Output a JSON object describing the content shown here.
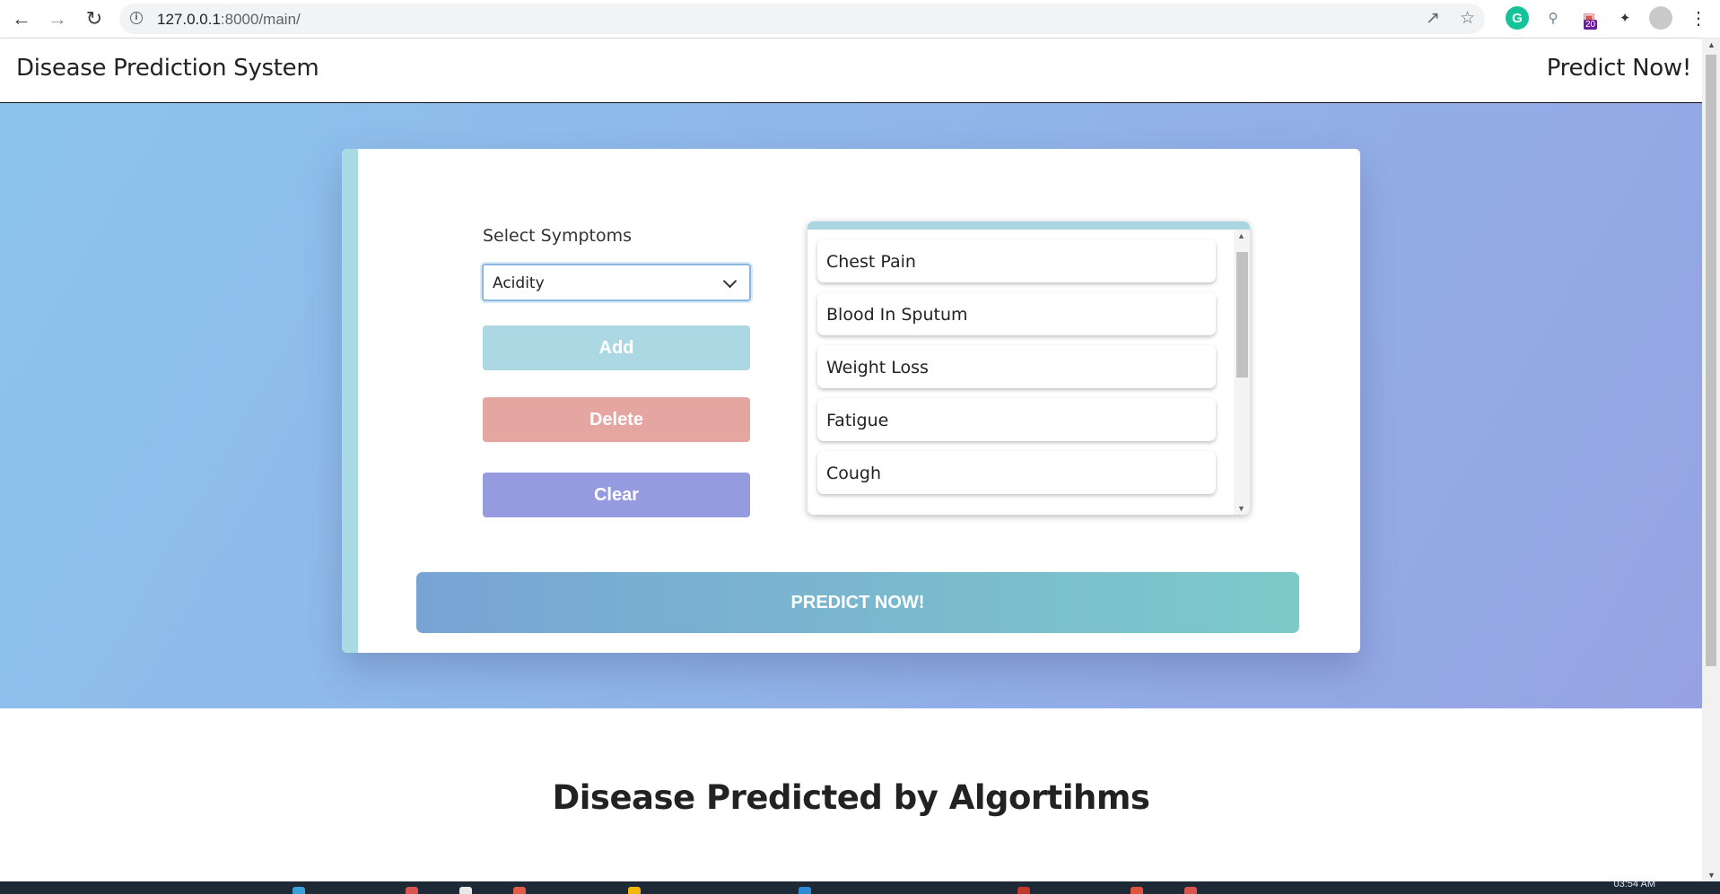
{
  "browser": {
    "url_host": "127.0.0.1",
    "url_path": ":8000/main/",
    "ext_badge": "20"
  },
  "navbar": {
    "brand": "Disease Prediction System",
    "link": "Predict Now!"
  },
  "form": {
    "select_label": "Select Symptoms",
    "selected_symptom": "Acidity",
    "add_label": "Add",
    "delete_label": "Delete",
    "clear_label": "Clear",
    "predict_label": "PREDICT NOW!"
  },
  "symptoms": [
    "Chest Pain",
    "Blood In Sputum",
    "Weight Loss",
    "Fatigue",
    "Cough"
  ],
  "results": {
    "title": "Disease Predicted by Algortihms"
  },
  "taskbar": {
    "clock": "03:54 AM"
  },
  "colors": {
    "hero_start": "#8cc4ec",
    "hero_end": "#96a2e4",
    "add": "#acd8e4",
    "delete": "#e5a6a2",
    "clear": "#969be0",
    "predict_start": "#78a4d4",
    "predict_end": "#7ccaca"
  }
}
